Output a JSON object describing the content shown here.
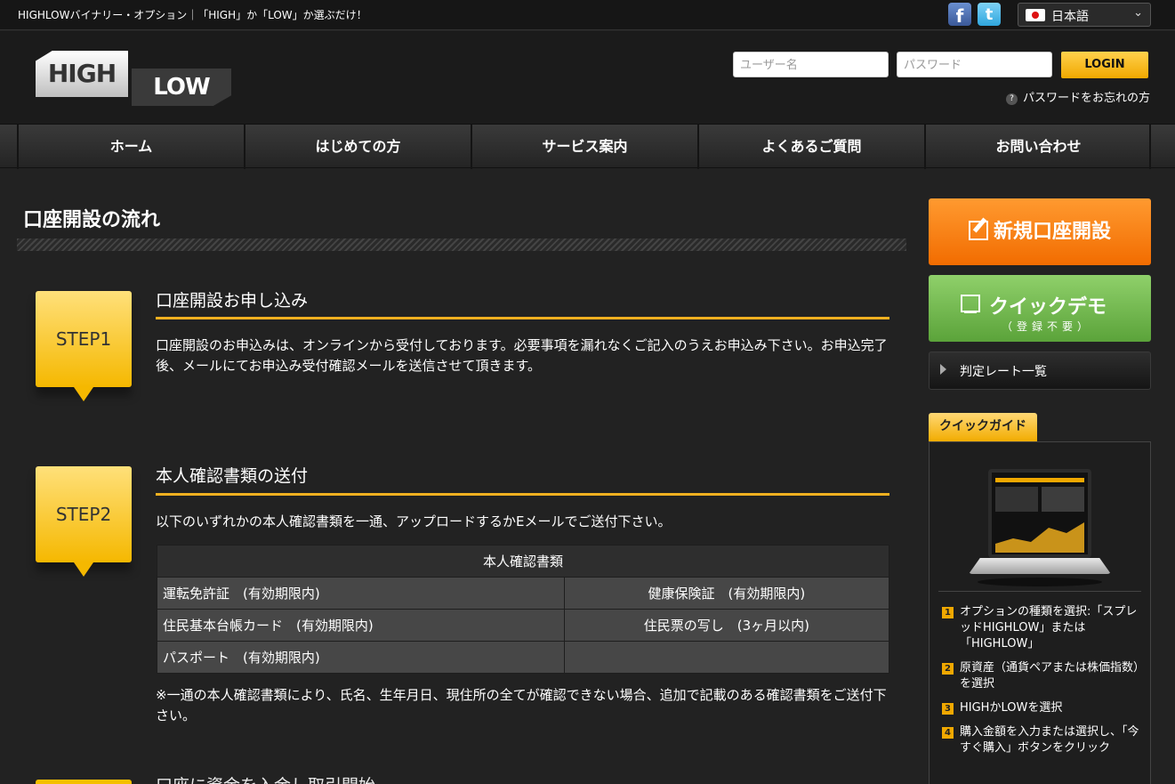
{
  "topbar": {
    "tagline": "HIGHLOWバイナリー・オプション｜「HIGH」か「LOW」か選ぶだけ！",
    "language": "日本語",
    "icons": {
      "facebook": "facebook-icon",
      "twitter": "twitter-icon",
      "flag": "japan-flag-icon"
    }
  },
  "header": {
    "logo_high": "HIGH",
    "logo_low": "LOW",
    "username_placeholder": "ユーザー名",
    "password_placeholder": "パスワード",
    "login_label": "LOGIN",
    "forgot_password": "パスワードをお忘れの方"
  },
  "nav": {
    "items": [
      {
        "label": "ホーム"
      },
      {
        "label": "はじめての方"
      },
      {
        "label": "サービス案内"
      },
      {
        "label": "よくあるご質問"
      },
      {
        "label": "お問い合わせ"
      }
    ]
  },
  "main": {
    "page_title": "口座開設の流れ",
    "steps": [
      {
        "badge": "STEP1",
        "title": "口座開設お申し込み",
        "text": "口座開設のお申込みは、オンラインから受付しております。必要事項を漏れなくご記入のうえお申込み下さい。お申込完了後、メールにてお申込み受付確認メールを送信させて頂きます。"
      },
      {
        "badge": "STEP2",
        "title": "本人確認書類の送付",
        "text": "以下のいずれかの本人確認書類を一通、アップロードするかEメールでご送付下さい。",
        "table_header": "本人確認書類",
        "table_rows": [
          [
            "運転免許証　(有効期限内)",
            "健康保険証　(有効期限内)"
          ],
          [
            "住民基本台帳カード　(有効期限内)",
            "住民票の写し　(3ヶ月以内)"
          ],
          [
            "パスポート　(有効期限内)",
            ""
          ]
        ],
        "note": "※一通の本人確認書類により、氏名、生年月日、現住所の全てが確認できない場合、追加で記載のある確認書類をご送付下さい。"
      },
      {
        "title": "口座に資金を入金し取引開始"
      }
    ]
  },
  "sidebar": {
    "new_account": "新規口座開設",
    "quick_demo": "クイックデモ",
    "quick_demo_sub": "（登録不要）",
    "rate_list": "判定レート一覧",
    "guide_tab": "クイックガイド",
    "guide_items": [
      {
        "num": "1",
        "text": "オプションの種類を選択:「スプレッドHIGHLOW」または「HIGHLOW」"
      },
      {
        "num": "2",
        "text": "原資産（通貨ペアまたは株価指数）を選択"
      },
      {
        "num": "3",
        "text": "HIGHかLOWを選択"
      },
      {
        "num": "4",
        "text": "購入金額を入力または選択し、「今すぐ購入」ボタンをクリック"
      }
    ]
  },
  "colors": {
    "accent": "#f0b020",
    "new_account_button": "#f26c00",
    "demo_button": "#5ba33a",
    "background": "#222222"
  }
}
